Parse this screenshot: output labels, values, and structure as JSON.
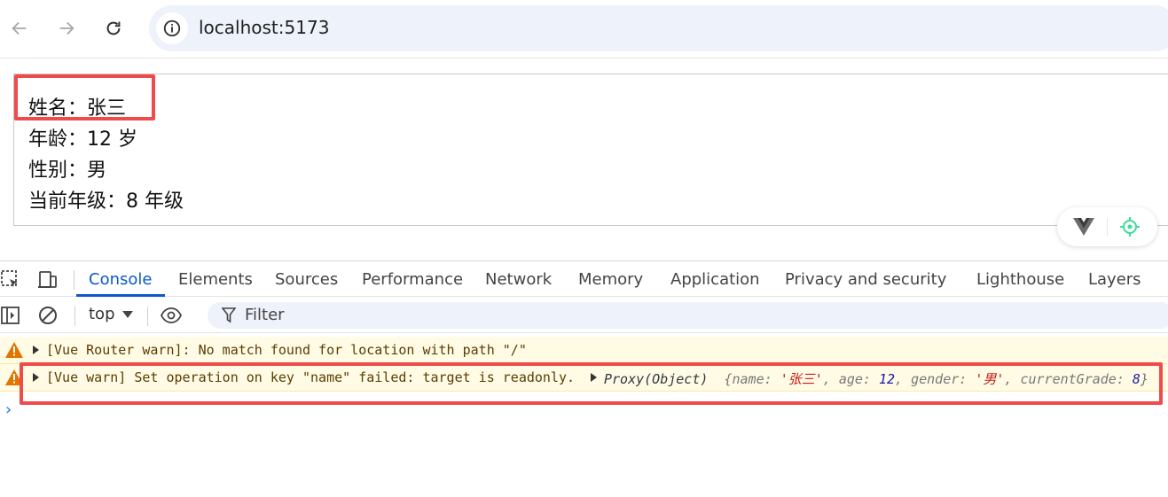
{
  "browser": {
    "url": "localhost:5173",
    "back_icon": "arrow-left-icon",
    "forward_icon": "arrow-right-icon",
    "reload_icon": "reload-icon",
    "info_icon": "info-icon"
  },
  "page": {
    "lines": [
      "姓名：张三",
      "年龄：12 岁",
      "性别：男",
      "当前年级：8 年级"
    ],
    "highlight_color": "#ef4b4b"
  },
  "vue_devtools": {
    "logo_icon": "vue-logo-icon",
    "inspect_icon": "crosshair-icon",
    "accent": "#3ddc97"
  },
  "devtools": {
    "tabs": [
      "Console",
      "Elements",
      "Sources",
      "Performance",
      "Network",
      "Memory",
      "Application",
      "Privacy and security",
      "Lighthouse",
      "Layers"
    ],
    "active_tab": "Console",
    "context": "top",
    "filter_placeholder": "Filter",
    "accent": "#0b57d0"
  },
  "console": {
    "messages": [
      {
        "level": "warning",
        "text": "[Vue Router warn]: No match found for location with path \"/\""
      },
      {
        "level": "warning",
        "text": "[Vue warn] Set operation on key \"name\" failed: target is readonly.",
        "object_label": "Proxy(Object)",
        "object": {
          "name_key": "name",
          "name_val": "'张三'",
          "age_key": "age",
          "age_val": "12",
          "gender_key": "gender",
          "gender_val": "'男'",
          "grade_key": "currentGrade",
          "grade_val": "8"
        }
      }
    ],
    "prompt": "›",
    "warning_bg": "#fffbe5"
  }
}
